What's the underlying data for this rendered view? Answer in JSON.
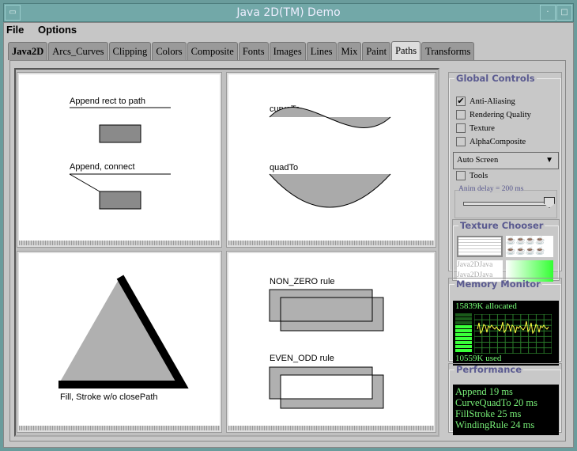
{
  "window": {
    "title": "Java 2D(TM) Demo"
  },
  "menu": [
    "File",
    "Options"
  ],
  "tabs": [
    "Java2D",
    "Arcs_Curves",
    "Clipping",
    "Colors",
    "Composite",
    "Fonts",
    "Images",
    "Lines",
    "Mix",
    "Paint",
    "Paths",
    "Transforms"
  ],
  "active_tab": "Paths",
  "panels": {
    "append": {
      "label1": "Append rect to path",
      "label2": "Append, connect"
    },
    "curves": {
      "label1": "curveTo",
      "label2": "quadTo"
    },
    "fillstroke": {
      "label": "Fill, Stroke w/o closePath"
    },
    "winding": {
      "label1": "NON_ZERO rule",
      "label2": "EVEN_ODD rule"
    }
  },
  "global_controls": {
    "title": "Global Controls",
    "checkboxes": [
      {
        "label": "Anti-Aliasing",
        "checked": true
      },
      {
        "label": "Rendering Quality",
        "checked": false
      },
      {
        "label": "Texture",
        "checked": false
      },
      {
        "label": "AlphaComposite",
        "checked": false
      }
    ],
    "screen_select": "Auto Screen",
    "tools": {
      "label": "Tools",
      "checked": false
    },
    "anim_delay": {
      "label": "Anim delay = 200 ms",
      "value_fraction": 1.0
    }
  },
  "texture_chooser": {
    "title": "Texture Chooser",
    "text_texture": [
      "Java2DJava",
      "Java2DJava"
    ]
  },
  "memory_monitor": {
    "title": "Memory Monitor",
    "allocated": "15839K allocated",
    "used": "10559K used",
    "used_fraction": 0.67
  },
  "performance": {
    "title": "Performance",
    "lines": [
      "Append 19 ms",
      "CurveQuadTo 20 ms",
      "FillStroke 25 ms",
      "WindingRule 24 ms"
    ]
  },
  "colors": {
    "frame": "#6a9c9c",
    "panel": "#c6c6c6",
    "monitor_green": "#39ff39",
    "monitor_line": "#ffff44",
    "legend": "#5a5a90"
  }
}
